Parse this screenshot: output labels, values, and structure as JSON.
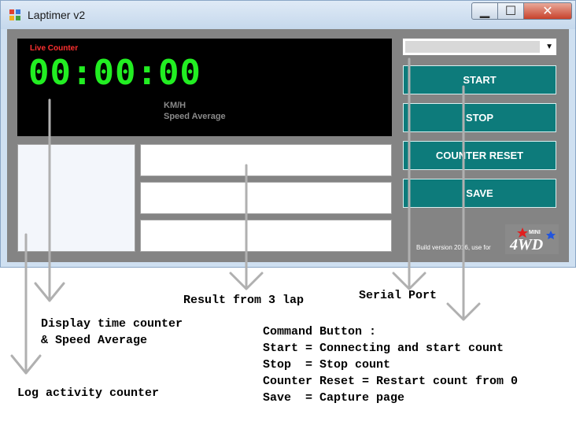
{
  "window": {
    "title": "Laptimer v2",
    "minimize_glyph": "▁",
    "maximize_glyph": "☐",
    "close_glyph": "✕"
  },
  "display": {
    "live_label": "Live Counter",
    "timer": "00:00:00",
    "speed_unit": "KM/H",
    "speed_label": "Speed Average"
  },
  "serial_port": {
    "selected": ""
  },
  "buttons": {
    "start": "START",
    "stop": "STOP",
    "counter_reset": "COUNTER RESET",
    "save": "SAVE"
  },
  "footer": {
    "build_text": "Build version 2016, use for",
    "logo_text": "MINI 4WD"
  },
  "annotations": {
    "result": "Result from 3 lap",
    "serial": "Serial Port",
    "display": "Display time counter\n& Speed Average",
    "log": "Log activity counter",
    "commands": "Command Button :\nStart = Connecting and start count\nStop  = Stop count\nCounter Reset = Restart count from 0\nSave  = Capture page"
  },
  "colors": {
    "teal": "#0d7b7b",
    "timer_green": "#22ee22",
    "live_red": "#ff3030"
  }
}
